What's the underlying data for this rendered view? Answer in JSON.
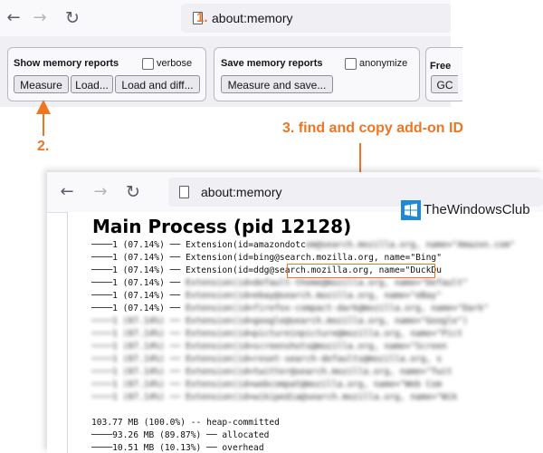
{
  "top_browser": {
    "url": "about:memory",
    "step_marker": "1.",
    "show_reports": {
      "legend": "Show memory reports",
      "verbose_label": "verbose",
      "measure_label": "Measure",
      "load_label": "Load...",
      "load_diff_label": "Load and diff..."
    },
    "save_reports": {
      "legend": "Save memory reports",
      "anonymize_label": "anonymize",
      "measure_save_label": "Measure and save..."
    },
    "free_memory": {
      "legend": "Free",
      "gc_label": "GC"
    }
  },
  "annotations": {
    "step2": "2.",
    "step3": "3. find and copy add-on ID",
    "color": "#ED7625"
  },
  "bottom_browser": {
    "url": "about:memory",
    "heading": "Main Process (pid 12128)",
    "rows": [
      {
        "pct": "────1 (07.14%) ── ",
        "text": "Extension(id=amazondotc",
        "blurred_tail": "om@search.mozilla.org, name=\"Amazon.com\""
      },
      {
        "pct": "────1 (07.14%) ── ",
        "text": "Extension(id=bing@search.mozilla.org, name=\"Bing\"",
        "blurred_tail": ""
      },
      {
        "pct": "────1 (07.14%) ── ",
        "text": "Extension(id=ddg@search.mozilla.org, name=\"DuckDu",
        "blurred_tail": ""
      },
      {
        "pct": "────1 (07.14%) ── ",
        "text": "",
        "blurred_tail": "Extension(id=default-theme@mozilla.org, name=\"Default\""
      },
      {
        "pct": "────1 (07.14%) ── ",
        "text": "",
        "blurred_tail": "Extension(id=ebay@search.mozilla.org, name=\"eBay\""
      },
      {
        "pct": "────1 (07.14%) ── ",
        "text": "",
        "blurred_tail": "Extension(id=firefox-compact-dark@mozilla.org, name=\"Dark\""
      }
    ],
    "blurred_rows": [
      "────1 (07.14%) ── Extension(id=google@search.mozilla.org, name=\"Google\")",
      "────1 (07.14%) ── Extension(id=pictureinpicture@mozilla.org, name=\"Pict",
      "────1 (07.14%) ── Extension(id=screenshots@mozilla.org, name=\"Screen",
      "────1 (07.14%) ── Extension(id=reset-search-defaults@mozilla.org, s",
      "────1 (07.14%) ── Extension(id=twitter@search.mozilla.org, name=\"Twit",
      "────1 (07.14%) ── Extension(id=webcompat@mozilla.org, name=\"Web Com",
      "────1 (07.14%) ── Extension(id=wikipedia@search.mozilla.org, name=\"Wik"
    ],
    "summary": {
      "total": "103.77 MB (100.0%) -- heap-committed",
      "allocated": "────93.26 MB (89.87%) ── allocated",
      "overhead": "────10.51 MB (10.13%) ── overhead"
    }
  },
  "watermark": {
    "text": "TheWindowsClub",
    "logo_color": "#1e8ad6"
  }
}
